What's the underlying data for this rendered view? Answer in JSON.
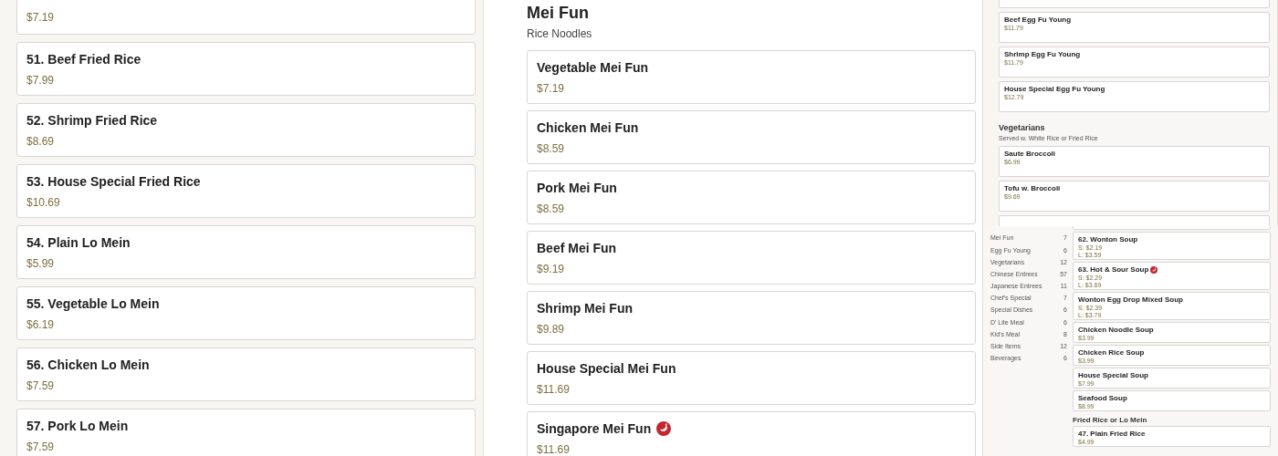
{
  "left_column": {
    "cut_card_price": "$7.19",
    "items": [
      {
        "name": "51. Beef Fried Rice",
        "price": "$7.99"
      },
      {
        "name": "52. Shrimp Fried Rice",
        "price": "$8.69"
      },
      {
        "name": "53. House Special Fried Rice",
        "price": "$10.69"
      },
      {
        "name": "54. Plain Lo Mein",
        "price": "$5.99"
      },
      {
        "name": "55. Vegetable Lo Mein",
        "price": "$6.19"
      },
      {
        "name": "56. Chicken Lo Mein",
        "price": "$7.59"
      },
      {
        "name": "57. Pork Lo Mein",
        "price": "$7.59"
      }
    ]
  },
  "center_column": {
    "title": "Mei Fun",
    "subtitle": "Rice Noodles",
    "items": [
      {
        "name": "Vegetable Mei Fun",
        "price": "$7.19",
        "spicy": false
      },
      {
        "name": "Chicken Mei Fun",
        "price": "$8.59",
        "spicy": false
      },
      {
        "name": "Pork Mei Fun",
        "price": "$8.59",
        "spicy": false
      },
      {
        "name": "Beef Mei Fun",
        "price": "$9.19",
        "spicy": false
      },
      {
        "name": "Shrimp Mei Fun",
        "price": "$9.89",
        "spicy": false
      },
      {
        "name": "House Special Mei Fun",
        "price": "$11.69",
        "spicy": false
      },
      {
        "name": "Singapore Mei Fun",
        "price": "$11.69",
        "spicy": true
      }
    ]
  },
  "preview_top": {
    "items": [
      {
        "name": "Beef Egg Fu Young",
        "price": "$11.79"
      },
      {
        "name": "Shrimp Egg Fu Young",
        "price": "$11.79"
      },
      {
        "name": "House Special Egg Fu Young",
        "price": "$12.79"
      }
    ],
    "section": {
      "title": "Vegetarians",
      "subtitle": "Served w. White Rice or Fried Rice",
      "items": [
        {
          "name": "Saute Broccoli",
          "price": "$6.99"
        },
        {
          "name": "Tofu w. Broccoli",
          "price": "$9.69"
        }
      ]
    }
  },
  "preview_bottom": {
    "categories": [
      {
        "name": "Mei Fun",
        "count": "7"
      },
      {
        "name": "Egg Fu Young",
        "count": "6"
      },
      {
        "name": "Vegetarians",
        "count": "12"
      },
      {
        "name": "Chinese Entrees",
        "count": "57"
      },
      {
        "name": "Japanese Entrees",
        "count": "11"
      },
      {
        "name": "Chef's Special",
        "count": "7"
      },
      {
        "name": "Special Dishes",
        "count": "6"
      },
      {
        "name": "D' Lite Meal",
        "count": "6"
      },
      {
        "name": "Kid's Meal",
        "count": "8"
      },
      {
        "name": "Side Items",
        "count": "12"
      },
      {
        "name": "Beverages",
        "count": "6"
      }
    ],
    "items": [
      {
        "name": "62. Wonton Soup",
        "prices": [
          "S: $2.19",
          "L: $3.59"
        ],
        "spicy": false
      },
      {
        "name": "63. Hot & Sour Soup",
        "prices": [
          "S: $2.29",
          "L: $3.69"
        ],
        "spicy": true
      },
      {
        "name": "Wonton Egg Drop Mixed Soup",
        "prices": [
          "S: $2.39",
          "L: $3.79"
        ],
        "spicy": false
      },
      {
        "name": "Chicken Noodle Soup",
        "prices": [
          "$3.99"
        ],
        "spicy": false
      },
      {
        "name": "Chicken Rice Soup",
        "prices": [
          "$3.99"
        ],
        "spicy": false
      },
      {
        "name": "House Special Soup",
        "prices": [
          "$7.99"
        ],
        "spicy": false
      },
      {
        "name": "Seafood Soup",
        "prices": [
          "$8.99"
        ],
        "spicy": false
      }
    ],
    "section": {
      "title": "Fried Rice or Lo Mein",
      "items": [
        {
          "name": "47. Plain Fried Rice",
          "prices": [
            "$4.99"
          ],
          "spicy": false
        }
      ]
    }
  }
}
